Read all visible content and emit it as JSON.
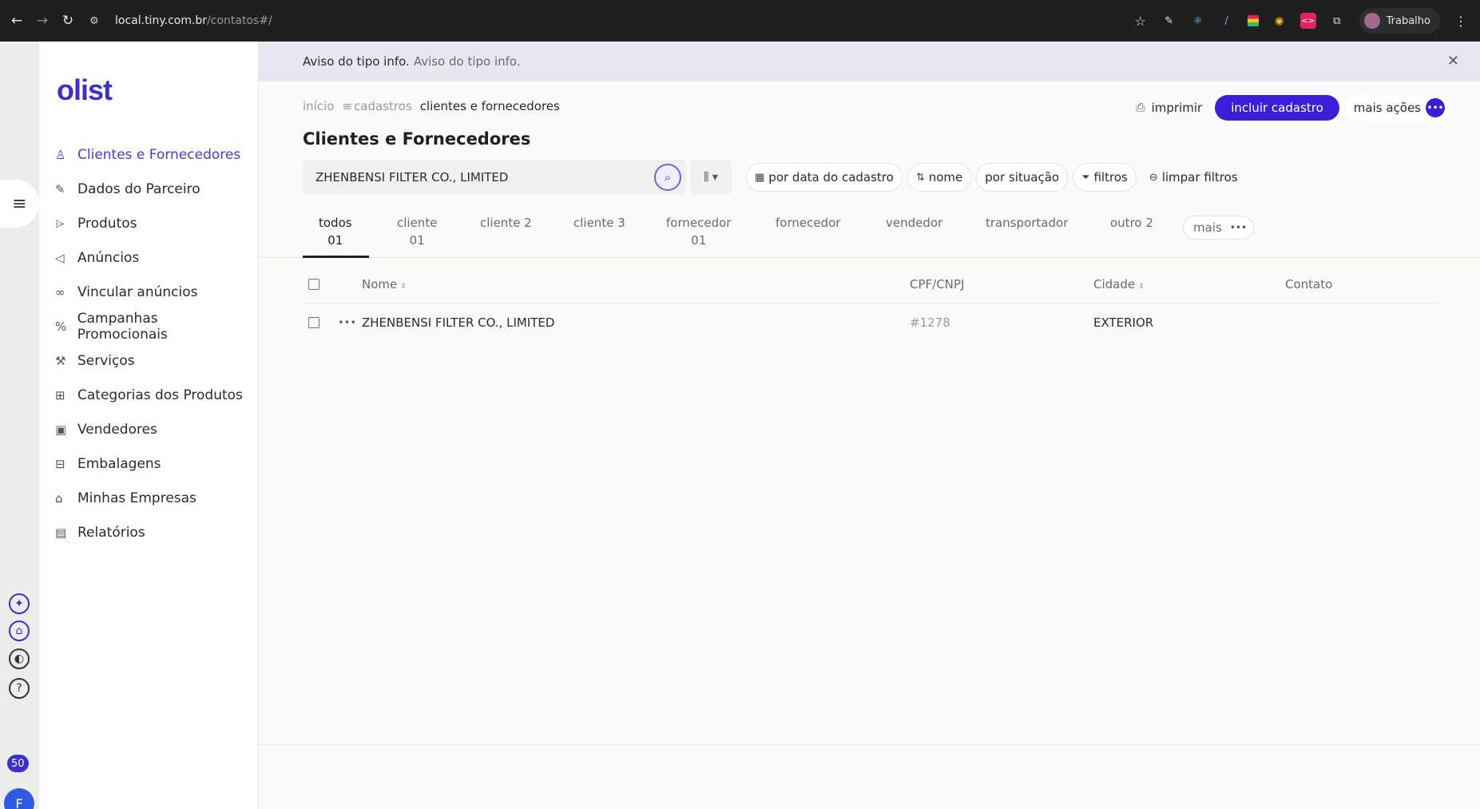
{
  "browser": {
    "url_host": "local.tiny.com.br",
    "url_path": "/contatos#/",
    "profile_name": "Trabalho"
  },
  "sidebar": {
    "logo": "olist",
    "items": [
      {
        "label": "Clientes e Fornecedores",
        "icon": "user-icon",
        "active": true
      },
      {
        "label": "Dados do Parceiro",
        "icon": "edit-icon"
      },
      {
        "label": "Produtos",
        "icon": "tag-icon"
      },
      {
        "label": "Anúncios",
        "icon": "megaphone-icon"
      },
      {
        "label": "Vincular anúncios",
        "icon": "link-icon"
      },
      {
        "label": "Campanhas Promocionais",
        "icon": "percent-icon"
      },
      {
        "label": "Serviços",
        "icon": "wrench-icon"
      },
      {
        "label": "Categorias dos Produtos",
        "icon": "hierarchy-icon"
      },
      {
        "label": "Vendedores",
        "icon": "briefcase-icon"
      },
      {
        "label": "Embalagens",
        "icon": "gift-icon"
      },
      {
        "label": "Minhas Empresas",
        "icon": "bank-icon"
      },
      {
        "label": "Relatórios",
        "icon": "report-icon"
      }
    ]
  },
  "rail": {
    "badge": "50",
    "avatar_letter": "F"
  },
  "banner": {
    "strong": "Aviso do tipo info.",
    "text": "Aviso do tipo info."
  },
  "breadcrumb": {
    "home": "início",
    "section": "cadastros",
    "current": "clientes e fornecedores"
  },
  "actions": {
    "print": "imprimir",
    "primary": "incluir cadastro",
    "more": "mais ações"
  },
  "page_title": "Clientes e Fornecedores",
  "search": {
    "value": "ZHENBENSI FILTER CO., LIMITED"
  },
  "filters": {
    "by_date": "por data do cadastro",
    "name": "nome",
    "by_status": "por situação",
    "filters": "filtros",
    "clear": "limpar filtros"
  },
  "tabs": [
    {
      "label": "todos",
      "count": "01",
      "active": true
    },
    {
      "label": "cliente",
      "count": "01"
    },
    {
      "label": "cliente 2",
      "count": ""
    },
    {
      "label": "cliente 3",
      "count": ""
    },
    {
      "label": "fornecedor",
      "count": "01"
    },
    {
      "label": "fornecedor",
      "count": ""
    },
    {
      "label": "vendedor",
      "count": ""
    },
    {
      "label": "transportador",
      "count": ""
    },
    {
      "label": "outro 2",
      "count": ""
    }
  ],
  "tabs_more": "mais",
  "table": {
    "headers": {
      "name": "Nome",
      "doc": "CPF/CNPJ",
      "city": "Cidade",
      "contact": "Contato"
    },
    "rows": [
      {
        "name": "ZHENBENSI FILTER CO., LIMITED",
        "doc": "#1278",
        "city": "EXTERIOR",
        "contact": ""
      }
    ]
  },
  "colors": {
    "brand": "#3b30c9",
    "primary_button": "#3b1fd6",
    "banner_bg": "#e7e7f2"
  }
}
